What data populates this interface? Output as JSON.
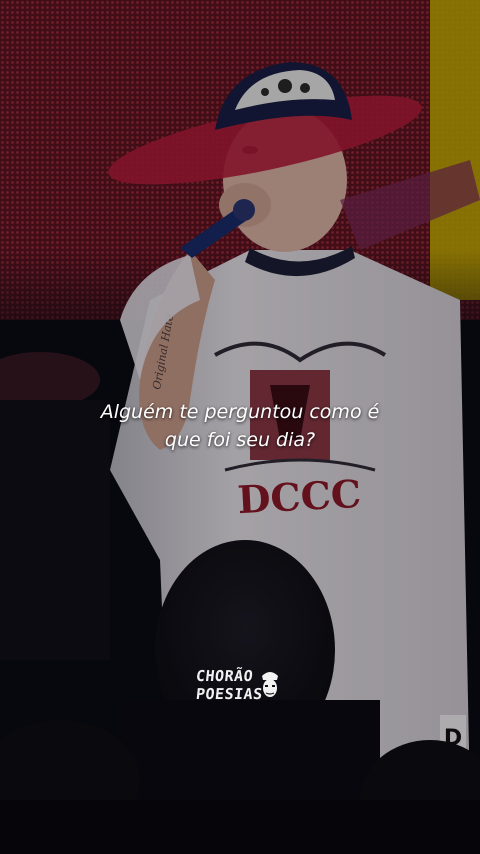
{
  "caption": {
    "line1": "Alguém te perguntou como é",
    "line2": "que foi seu dia?"
  },
  "logo": {
    "line1": "CHORÃO",
    "line2": "POESIAS"
  },
  "colors": {
    "background": "#0a0a12",
    "stage_red": "#8a1d2e",
    "stage_yellow": "#d8c000",
    "shirt": "#ded9df",
    "shirt_print": "#7a1a28",
    "hat_brim": "#b21c3a",
    "caption_text": "#ffffff"
  }
}
